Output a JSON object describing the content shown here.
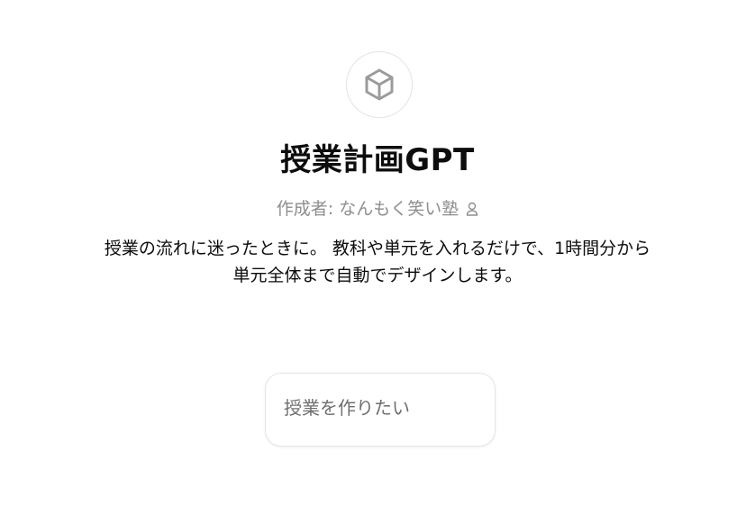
{
  "gpt": {
    "icon": "cube-icon",
    "title": "授業計画GPT",
    "author_label": "作成者: なんもく笑い塾",
    "author_icon": "person-icon",
    "description_line1": "授業の流れに迷ったときに。 教科や単元を入れるだけで、1時間分から",
    "description_line2": "単元全体まで自動でデザインします。"
  },
  "conversation_starters": [
    {
      "label": "授業を作りたい"
    }
  ],
  "colors": {
    "title": "#0d0d0d",
    "muted": "#8e8e8e",
    "border": "#e3e3e3"
  }
}
